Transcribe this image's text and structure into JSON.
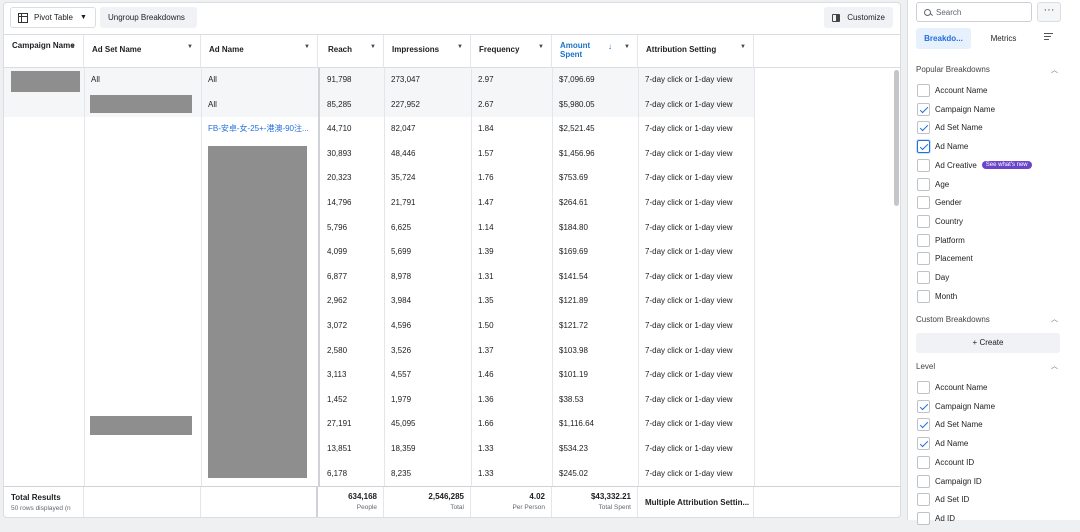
{
  "toolbar": {
    "pivot_label": "Pivot Table",
    "ungroup_label": "Ungroup Breakdowns",
    "customize_label": "Customize"
  },
  "columns": [
    {
      "key": "campaign",
      "label": "Campaign Name"
    },
    {
      "key": "adset",
      "label": "Ad Set Name"
    },
    {
      "key": "ad",
      "label": "Ad Name"
    },
    {
      "key": "reach",
      "label": "Reach"
    },
    {
      "key": "impressions",
      "label": "Impressions"
    },
    {
      "key": "frequency",
      "label": "Frequency"
    },
    {
      "key": "amount",
      "label": "Amount Spent"
    },
    {
      "key": "attribution",
      "label": "Attribution Setting"
    }
  ],
  "rows": [
    {
      "adset": "All",
      "ad": "All",
      "reach": "91,798",
      "impressions": "273,047",
      "frequency": "2.97",
      "amount": "$7,096.69",
      "attribution": "7-day click or 1-day view"
    },
    {
      "adset": "",
      "ad": "All",
      "reach": "85,285",
      "impressions": "227,952",
      "frequency": "2.67",
      "amount": "$5,980.05",
      "attribution": "7-day click or 1-day view"
    },
    {
      "adset": "",
      "ad": "FB-安卓-女-25+-港澳-90注...",
      "reach": "44,710",
      "impressions": "82,047",
      "frequency": "1.84",
      "amount": "$2,521.45",
      "attribution": "7-day click or 1-day view"
    },
    {
      "adset": "",
      "ad": "",
      "reach": "30,893",
      "impressions": "48,446",
      "frequency": "1.57",
      "amount": "$1,456.96",
      "attribution": "7-day click or 1-day view"
    },
    {
      "adset": "",
      "ad": "",
      "reach": "20,323",
      "impressions": "35,724",
      "frequency": "1.76",
      "amount": "$753.69",
      "attribution": "7-day click or 1-day view"
    },
    {
      "adset": "",
      "ad": "",
      "reach": "14,796",
      "impressions": "21,791",
      "frequency": "1.47",
      "amount": "$264.61",
      "attribution": "7-day click or 1-day view"
    },
    {
      "adset": "",
      "ad": "",
      "reach": "5,796",
      "impressions": "6,625",
      "frequency": "1.14",
      "amount": "$184.80",
      "attribution": "7-day click or 1-day view"
    },
    {
      "adset": "",
      "ad": "",
      "reach": "4,099",
      "impressions": "5,699",
      "frequency": "1.39",
      "amount": "$169.69",
      "attribution": "7-day click or 1-day view"
    },
    {
      "adset": "",
      "ad": "",
      "reach": "6,877",
      "impressions": "8,978",
      "frequency": "1.31",
      "amount": "$141.54",
      "attribution": "7-day click or 1-day view"
    },
    {
      "adset": "",
      "ad": "",
      "reach": "2,962",
      "impressions": "3,984",
      "frequency": "1.35",
      "amount": "$121.89",
      "attribution": "7-day click or 1-day view"
    },
    {
      "adset": "",
      "ad": "",
      "reach": "3,072",
      "impressions": "4,596",
      "frequency": "1.50",
      "amount": "$121.72",
      "attribution": "7-day click or 1-day view"
    },
    {
      "adset": "",
      "ad": "",
      "reach": "2,580",
      "impressions": "3,526",
      "frequency": "1.37",
      "amount": "$103.98",
      "attribution": "7-day click or 1-day view"
    },
    {
      "adset": "",
      "ad": "",
      "reach": "3,113",
      "impressions": "4,557",
      "frequency": "1.46",
      "amount": "$101.19",
      "attribution": "7-day click or 1-day view"
    },
    {
      "adset": "",
      "ad": "",
      "reach": "1,452",
      "impressions": "1,979",
      "frequency": "1.36",
      "amount": "$38.53",
      "attribution": "7-day click or 1-day view"
    },
    {
      "adset": "",
      "ad": "",
      "reach": "27,191",
      "impressions": "45,095",
      "frequency": "1.66",
      "amount": "$1,116.64",
      "attribution": "7-day click or 1-day view"
    },
    {
      "adset": "",
      "ad": "",
      "reach": "13,851",
      "impressions": "18,359",
      "frequency": "1.33",
      "amount": "$534.23",
      "attribution": "7-day click or 1-day view"
    },
    {
      "adset": "",
      "ad": "",
      "reach": "6,178",
      "impressions": "8,235",
      "frequency": "1.33",
      "amount": "$245.02",
      "attribution": "7-day click or 1-day view"
    }
  ],
  "totals": {
    "label": "Total Results",
    "sub": "50 rows displayed (n",
    "reach": "634,168",
    "reach_unit": "People",
    "impressions": "2,546,285",
    "impressions_unit": "Total",
    "frequency": "4.02",
    "frequency_unit": "Per Person",
    "amount": "$43,332.21",
    "amount_unit": "Total Spent",
    "attribution": "Multiple Attribution Settin..."
  },
  "sidebar": {
    "search_placeholder": "Search",
    "more_label": "···",
    "tab_breakdowns": "Breakdo...",
    "tab_metrics": "Metrics",
    "popular_title": "Popular Breakdowns",
    "popular": [
      {
        "label": "Account Name",
        "checked": false
      },
      {
        "label": "Campaign Name",
        "checked": true
      },
      {
        "label": "Ad Set Name",
        "checked": true
      },
      {
        "label": "Ad Name",
        "checked": true,
        "focus": true
      },
      {
        "label": "Ad Creative",
        "checked": false,
        "badge": "See what's new"
      },
      {
        "label": "Age",
        "checked": false
      },
      {
        "label": "Gender",
        "checked": false
      },
      {
        "label": "Country",
        "checked": false
      },
      {
        "label": "Platform",
        "checked": false
      },
      {
        "label": "Placement",
        "checked": false
      },
      {
        "label": "Day",
        "checked": false
      },
      {
        "label": "Month",
        "checked": false
      }
    ],
    "custom_title": "Custom Breakdowns",
    "create_label": "+ Create",
    "level_title": "Level",
    "level": [
      {
        "label": "Account Name",
        "checked": false
      },
      {
        "label": "Campaign Name",
        "checked": true
      },
      {
        "label": "Ad Set Name",
        "checked": true
      },
      {
        "label": "Ad Name",
        "checked": true
      },
      {
        "label": "Account ID",
        "checked": false
      },
      {
        "label": "Campaign ID",
        "checked": false
      },
      {
        "label": "Ad Set ID",
        "checked": false
      },
      {
        "label": "Ad ID",
        "checked": false
      }
    ]
  },
  "colors": {
    "accent": "#216fdb",
    "badge": "#6b45c9",
    "redaction": "#8e8e8e"
  }
}
